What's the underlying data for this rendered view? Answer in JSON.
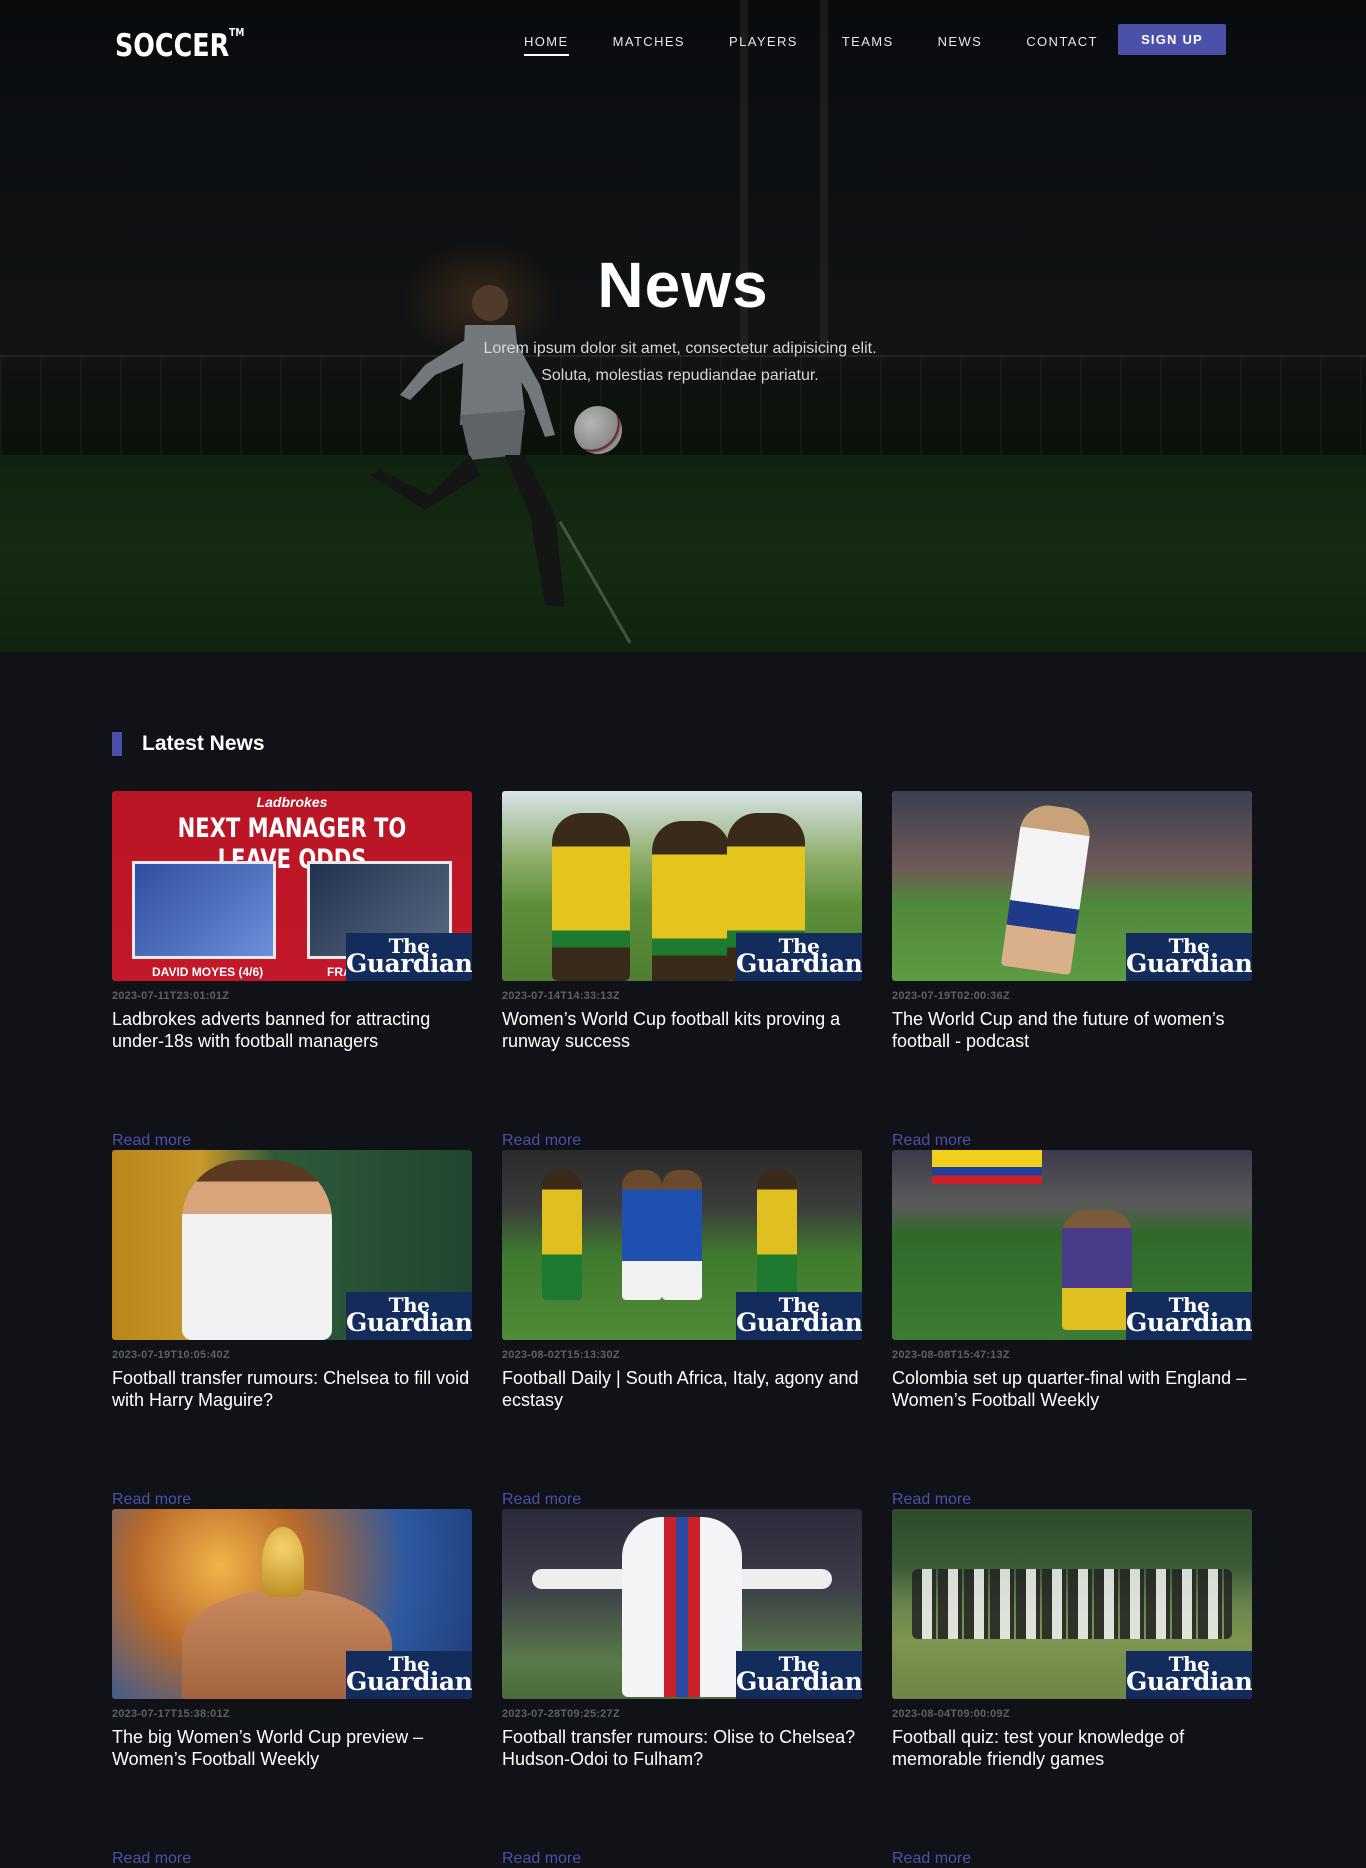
{
  "nav": {
    "logo": "SOCCER",
    "logo_tm": "TM",
    "items": [
      {
        "label": "HOME",
        "active": true
      },
      {
        "label": "MATCHES"
      },
      {
        "label": "PLAYERS"
      },
      {
        "label": "TEAMS"
      },
      {
        "label": "NEWS"
      },
      {
        "label": "CONTACT"
      }
    ],
    "signup_label": "SIGN UP"
  },
  "hero": {
    "title": "News",
    "subtitle": "Lorem ipsum dolor sit amet, consectetur adipisicing elit. Soluta, molestias repudiandae pariatur."
  },
  "section": {
    "title": "Latest News"
  },
  "guardian": {
    "line1": "The",
    "line2": "Guardian"
  },
  "articles": [
    {
      "date": "2023-07-11T23:01:01Z",
      "headline": "Ladbrokes adverts banned for attracting under-18s with football managers",
      "read_more": "Read more",
      "thumb_text": {
        "brand": "Ladbrokes",
        "big": "NEXT MANAGER TO LEAVE ODDS",
        "caption": "DAVID MOYES (4/6)",
        "caption2": "FRA"
      }
    },
    {
      "date": "2023-07-14T14:33:13Z",
      "headline": "Women’s World Cup football kits proving a runway success",
      "read_more": "Read more"
    },
    {
      "date": "2023-07-19T02:00:36Z",
      "headline": "The World Cup and the future of women’s football - podcast",
      "read_more": "Read more"
    },
    {
      "date": "2023-07-19T10:05:40Z",
      "headline": "Football transfer rumours: Chelsea to fill void with Harry Maguire?",
      "read_more": "Read more"
    },
    {
      "date": "2023-08-02T15:13:30Z",
      "headline": "Football Daily | South Africa, Italy, agony and ecstasy",
      "read_more": "Read more"
    },
    {
      "date": "2023-08-08T15:47:13Z",
      "headline": "Colombia set up quarter-final with England – Women’s Football Weekly",
      "read_more": "Read more"
    },
    {
      "date": "2023-07-17T15:38:01Z",
      "headline": "The big Women’s World Cup preview – Women’s Football Weekly",
      "read_more": "Read more"
    },
    {
      "date": "2023-07-28T09:25:27Z",
      "headline": "Football transfer rumours: Olise to Chelsea? Hudson-Odoi to Fulham?",
      "read_more": "Read more"
    },
    {
      "date": "2023-08-04T09:00:09Z",
      "headline": "Football quiz: test your knowledge of memorable friendly games",
      "read_more": "Read more"
    }
  ],
  "colors": {
    "accent": "#4b50a8",
    "background": "#101217",
    "guardian_badge": "#132c5c"
  }
}
